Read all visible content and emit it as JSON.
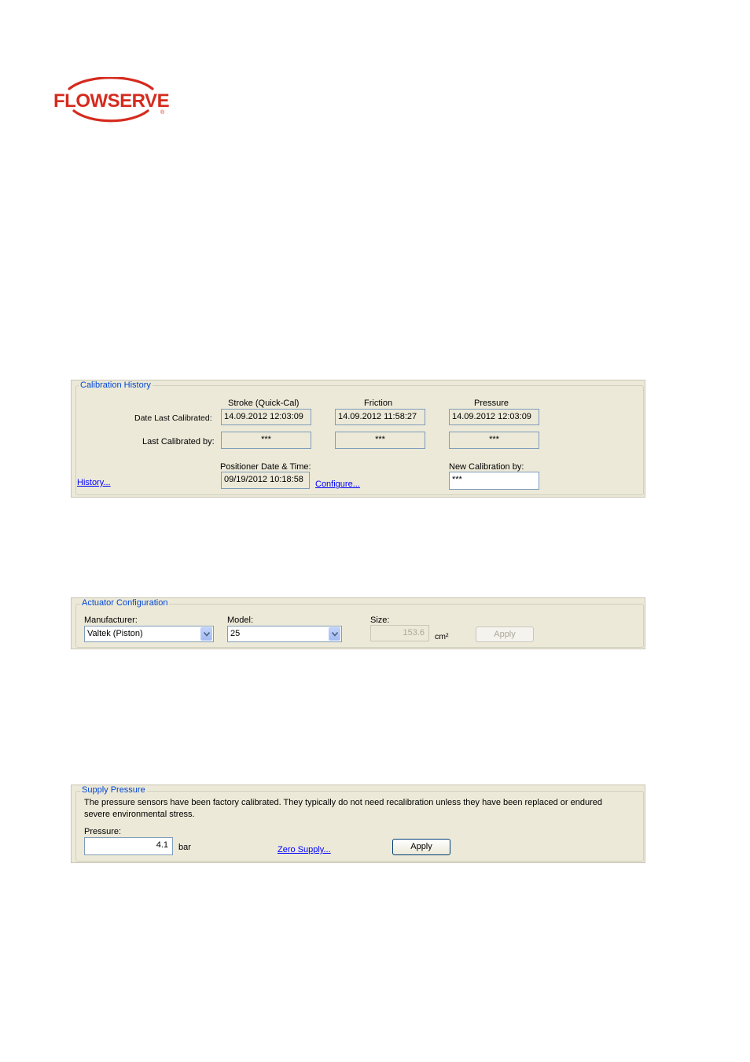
{
  "brand": {
    "name": "FLOWSERVE",
    "registered": "®",
    "color": "#d52b1e"
  },
  "calibration_history": {
    "legend": "Calibration History",
    "columns": [
      "Stroke (Quick-Cal)",
      "Friction",
      "Pressure"
    ],
    "row_date_label": "Date Last Calibrated:",
    "row_by_label": "Last Calibrated by:",
    "dates": [
      "14.09.2012 12:03:09",
      "14.09.2012 11:58:27",
      "14.09.2012 12:03:09"
    ],
    "by": [
      "***",
      "***",
      "***"
    ],
    "positioner_label": "Positioner Date & Time:",
    "positioner_value": "09/19/2012 10:18:58",
    "configure_link": "Configure...",
    "history_link": "History...",
    "new_cal_label": "New Calibration by:",
    "new_cal_value": "***"
  },
  "actuator_configuration": {
    "legend": "Actuator Configuration",
    "manufacturer_label": "Manufacturer:",
    "manufacturer_value": "Valtek (Piston)",
    "model_label": "Model:",
    "model_value": "25",
    "size_label": "Size:",
    "size_value": "153.6",
    "size_unit": "cm²",
    "apply_label": "Apply"
  },
  "supply_pressure": {
    "legend": "Supply Pressure",
    "description_line1": "The pressure sensors have been factory calibrated.  They typically do not need recalibration unless they have been replaced or endured",
    "description_line2": "severe environmental stress.",
    "pressure_label": "Pressure:",
    "pressure_value": "4.1",
    "pressure_unit": "bar",
    "zero_supply_link": "Zero Supply...",
    "apply_label": "Apply"
  }
}
